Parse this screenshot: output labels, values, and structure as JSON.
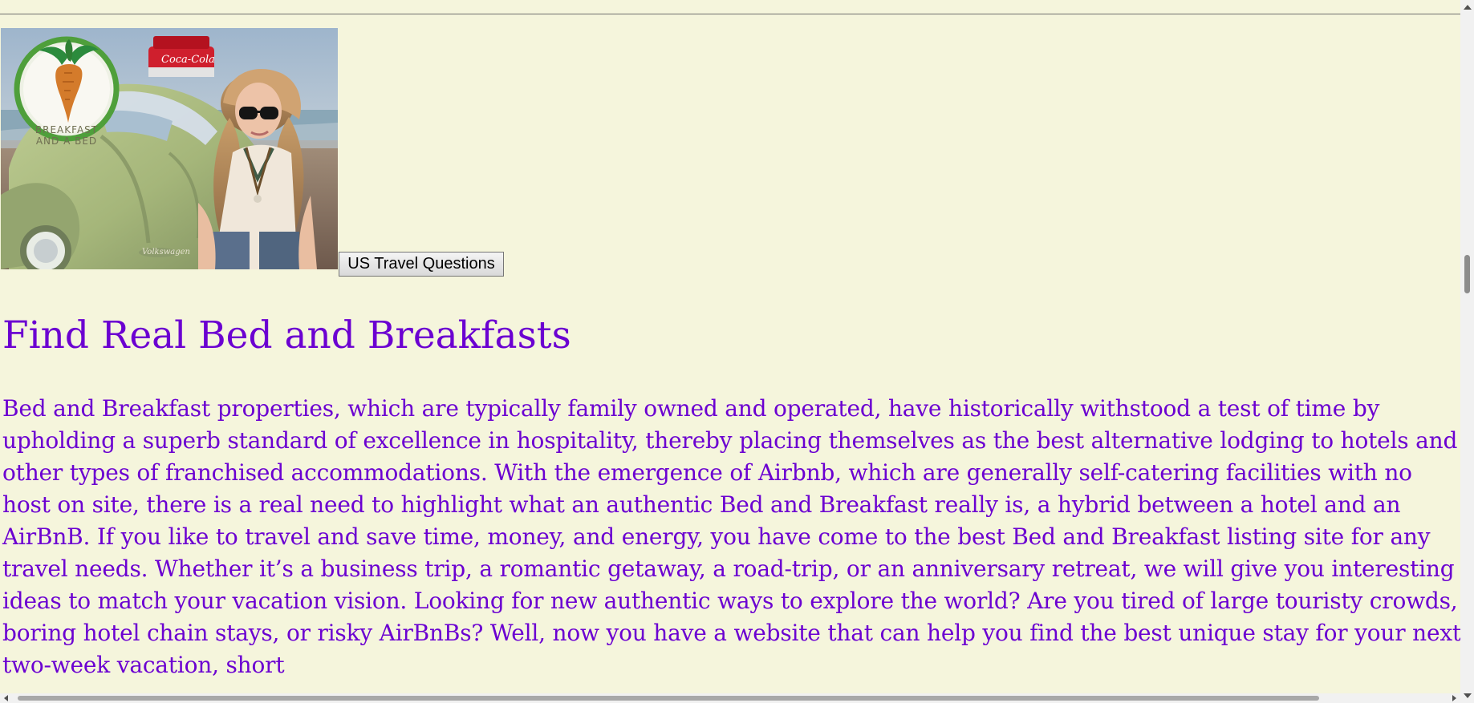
{
  "hero": {
    "logo_text_line1": "BREAKFAST",
    "logo_text_line2": "AND A BED"
  },
  "button": {
    "label": "US Travel Questions"
  },
  "title": "Find Real Bed and Breakfasts",
  "intro": "Bed and Breakfast properties, which are typically family owned and operated, have historically withstood a test of time by upholding a superb standard of excellence in hospitality, thereby placing themselves as the best alternative lodging to hotels and other types of franchised accommodations. With the emergence of Airbnb, which are generally self-catering facilities with no host on site, there is a real need to highlight what an authentic Bed and Breakfast really is, a hybrid between a hotel and an AirBnB. If you like to travel and save time, money, and energy, you have come to the best Bed and Breakfast listing site for any travel needs. Whether it’s a business trip, a romantic getaway, a road-trip, or an anniversary retreat, we will give you interesting ideas to match your vacation vision. Looking for new authentic ways to explore the world? Are you tired of large touristy crowds, boring hotel chain stays, or risky AirBnBs? Well, now you have a website that can help you find the best unique stay for your next two-week vacation, short",
  "icons": {
    "scroll_up": "chevron-up-icon",
    "scroll_down": "chevron-down-icon",
    "scroll_left": "chevron-left-icon",
    "scroll_right": "chevron-right-icon"
  },
  "colors": {
    "background": "#f5f5dc",
    "text": "#6b00d1",
    "logo_ring": "#4f9f3b",
    "car": "#a6b77a"
  }
}
